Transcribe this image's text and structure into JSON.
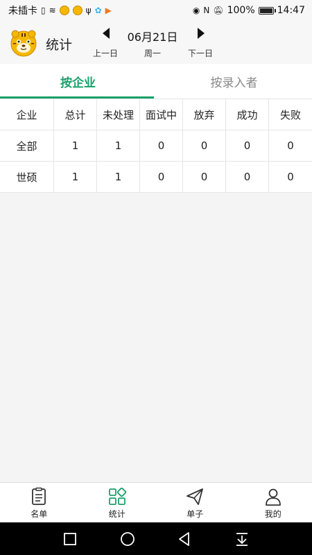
{
  "status_bar": {
    "carrier": "未插卡",
    "battery_percent": "100%",
    "time": "14:47"
  },
  "header": {
    "title": "统计",
    "date": "06月21日",
    "prev_label": "上一日",
    "weekday": "周一",
    "next_label": "下一日"
  },
  "tabs": [
    {
      "label": "按企业",
      "active": true
    },
    {
      "label": "按录入者",
      "active": false
    }
  ],
  "table": {
    "headers": [
      "企业",
      "总计",
      "未处理",
      "面试中",
      "放弃",
      "成功",
      "失败"
    ],
    "rows": [
      [
        "全部",
        "1",
        "1",
        "0",
        "0",
        "0",
        "0"
      ],
      [
        "世硕",
        "1",
        "1",
        "0",
        "0",
        "0",
        "0"
      ]
    ]
  },
  "bottom_nav": [
    {
      "label": "名单",
      "icon": "document-list-icon"
    },
    {
      "label": "统计",
      "icon": "grid-stats-icon",
      "active": true
    },
    {
      "label": "单子",
      "icon": "paper-plane-icon"
    },
    {
      "label": "我的",
      "icon": "user-icon"
    }
  ],
  "colors": {
    "accent": "#1aa06a",
    "background": "#f4f4f4",
    "surface": "#ffffff"
  }
}
